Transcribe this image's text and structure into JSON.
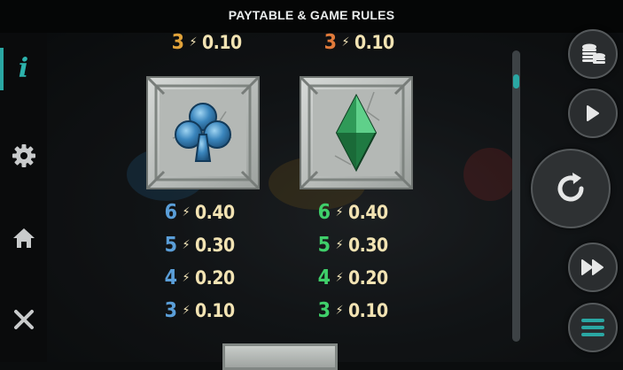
{
  "header": {
    "title": "PAYTABLE & GAME RULES"
  },
  "sidebar": {
    "items": [
      {
        "name": "info",
        "icon": "info-icon",
        "active": true
      },
      {
        "name": "settings",
        "icon": "gear-icon"
      },
      {
        "name": "home",
        "icon": "home-icon"
      },
      {
        "name": "close",
        "icon": "close-icon"
      }
    ],
    "info_glyph": "i",
    "accent": "#2aa7a3"
  },
  "paytable": {
    "bolt_symbol": "⚡",
    "partial_top": [
      {
        "count": "3",
        "value": "0.10",
        "count_color": "#e0a23a"
      },
      {
        "count": "3",
        "value": "0.10",
        "count_color": "#e07a3a"
      }
    ],
    "symbols": [
      {
        "name": "club",
        "icon": "club-icon",
        "payouts": [
          {
            "count": "6",
            "value": "0.40"
          },
          {
            "count": "5",
            "value": "0.30"
          },
          {
            "count": "4",
            "value": "0.20"
          },
          {
            "count": "3",
            "value": "0.10"
          }
        ],
        "count_color": "#5a9ed8"
      },
      {
        "name": "diamond",
        "icon": "diamond-icon",
        "payouts": [
          {
            "count": "6",
            "value": "0.40"
          },
          {
            "count": "5",
            "value": "0.30"
          },
          {
            "count": "4",
            "value": "0.20"
          },
          {
            "count": "3",
            "value": "0.10"
          }
        ],
        "count_color": "#3fcf6a"
      }
    ]
  },
  "controls": {
    "buttons": [
      {
        "name": "coins",
        "icon": "coins-icon"
      },
      {
        "name": "play",
        "icon": "play-icon"
      },
      {
        "name": "spin",
        "icon": "spin-icon"
      },
      {
        "name": "fast-forward",
        "icon": "fast-forward-icon"
      },
      {
        "name": "menu",
        "icon": "menu-icon"
      }
    ]
  },
  "scroll": {
    "position_fraction": 0.08
  }
}
